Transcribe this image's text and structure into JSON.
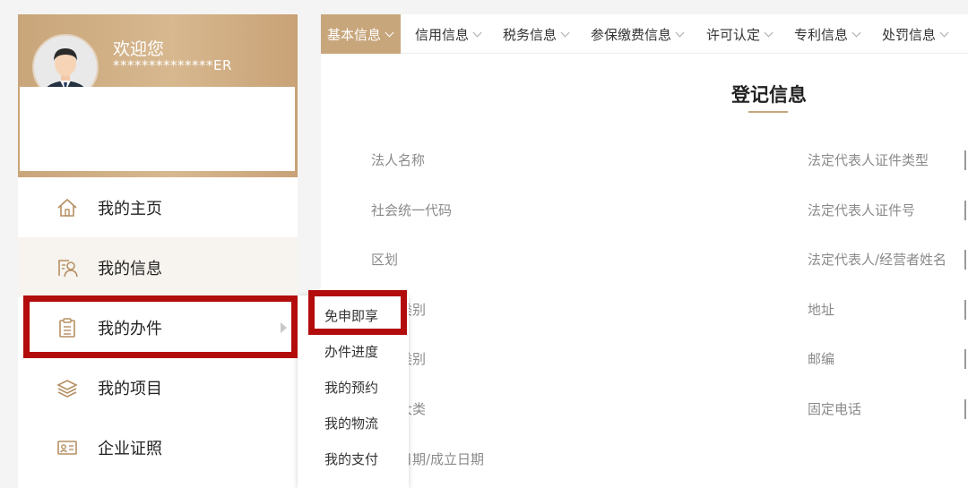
{
  "user": {
    "welcome": "欢迎您",
    "username": "**************ER"
  },
  "sidebar": {
    "items": [
      {
        "label": "我的主页",
        "icon": "home-icon"
      },
      {
        "label": "我的信息",
        "icon": "user-info-icon"
      },
      {
        "label": "我的办件",
        "icon": "clipboard-icon"
      },
      {
        "label": "我的项目",
        "icon": "layers-icon"
      },
      {
        "label": "企业证照",
        "icon": "id-card-icon"
      }
    ]
  },
  "submenu": {
    "items": [
      "免申即享",
      "办件进度",
      "我的预约",
      "我的物流",
      "我的支付"
    ]
  },
  "tabs": [
    "基本信息",
    "信用信息",
    "税务信息",
    "参保缴费信息",
    "许可认定",
    "专利信息",
    "处罚信息"
  ],
  "section": {
    "title": "登记信息"
  },
  "fields": {
    "left": [
      "法人名称",
      "社会统一代码",
      "区划",
      "类别",
      "类别",
      "大类",
      "日期/成立日期"
    ],
    "right": [
      "法定代表人证件类型",
      "法定代表人证件号",
      "法定代表人/经营者姓名",
      "地址",
      "邮编",
      "固定电话"
    ]
  },
  "colors": {
    "accent": "#c8a67c",
    "highlight": "#b30c0c"
  }
}
